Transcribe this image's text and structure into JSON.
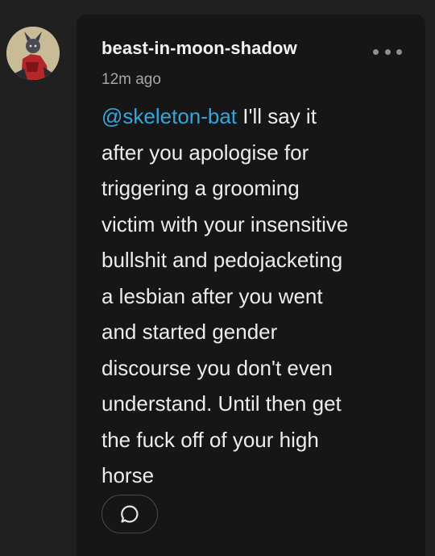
{
  "comment": {
    "username": "beast-in-moon-shadow",
    "timestamp": "12m ago",
    "mention": "@skeleton-bat",
    "lines": [
      "I'll say it",
      "after you apologise for",
      "triggering a grooming",
      "victim with your insensitive",
      "bullshit and pedojacketing",
      "a lesbian after you went",
      "and started gender",
      "discourse you don't even",
      "understand. Until then get",
      "the fuck off of your high",
      "horse"
    ],
    "more_icon": "ellipsis-icon",
    "reply_icon": "speech-bubble-icon"
  },
  "colors": {
    "background": "#202020",
    "card": "#161616",
    "username": "#f2f2f2",
    "timestamp": "#a6a6a6",
    "body_text": "#ececec",
    "mention": "#35a6dc"
  }
}
